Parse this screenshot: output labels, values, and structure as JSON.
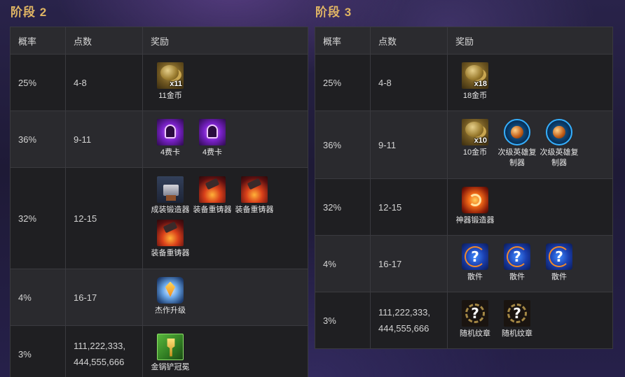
{
  "headers": {
    "rate": "概率",
    "points": "点数",
    "reward": "奖励"
  },
  "stage2": {
    "title": "阶段 2",
    "rows": [
      {
        "rate": "25%",
        "points": "4-8",
        "rewards": [
          {
            "icon": "gold-coins-icon",
            "qty": "x11",
            "label": "11金币"
          }
        ]
      },
      {
        "rate": "36%",
        "points": "9-11",
        "rewards": [
          {
            "icon": "four-cost-card-icon",
            "label": "4费卡"
          },
          {
            "icon": "four-cost-card-icon",
            "label": "4费卡"
          }
        ]
      },
      {
        "rate": "32%",
        "points": "12-15",
        "rewards": [
          {
            "icon": "item-anvil-icon",
            "label": "成装锻造器"
          },
          {
            "icon": "reforger-icon",
            "label": "装备重铸器"
          },
          {
            "icon": "reforger-icon",
            "label": "装备重铸器"
          },
          {
            "icon": "reforger-icon",
            "label": "装备重铸器"
          }
        ]
      },
      {
        "rate": "4%",
        "points": "16-17",
        "rewards": [
          {
            "icon": "masterwork-upgrade-icon",
            "label": "杰作升级"
          }
        ]
      },
      {
        "rate": "3%",
        "points_line1": "111,222,333,",
        "points_line2": "444,555,666",
        "rewards": [
          {
            "icon": "golden-spatula-icon",
            "label": "金锅铲冠冕"
          }
        ]
      }
    ]
  },
  "stage3": {
    "title": "阶段 3",
    "rows": [
      {
        "rate": "25%",
        "points": "4-8",
        "rewards": [
          {
            "icon": "gold-coins-icon",
            "qty": "x18",
            "label": "18金币"
          }
        ]
      },
      {
        "rate": "36%",
        "points": "9-11",
        "rewards": [
          {
            "icon": "gold-coins-icon",
            "qty": "x10",
            "label": "10金币"
          },
          {
            "icon": "lesser-champion-duplicator-icon",
            "label": "次级英雄复制器"
          },
          {
            "icon": "lesser-champion-duplicator-icon",
            "label": "次级英雄复制器"
          }
        ]
      },
      {
        "rate": "32%",
        "points": "12-15",
        "rewards": [
          {
            "icon": "artifact-anvil-icon",
            "label": "神器锻造器"
          }
        ]
      },
      {
        "rate": "4%",
        "points": "16-17",
        "rewards": [
          {
            "icon": "component-icon",
            "label": "散件"
          },
          {
            "icon": "component-icon",
            "label": "散件"
          },
          {
            "icon": "component-icon",
            "label": "散件"
          }
        ]
      },
      {
        "rate": "3%",
        "points_line1": "111,222,333,",
        "points_line2": "444,555,666",
        "rewards": [
          {
            "icon": "random-emblem-icon",
            "label": "随机纹章"
          },
          {
            "icon": "random-emblem-icon",
            "label": "随机纹章"
          }
        ]
      }
    ]
  }
}
